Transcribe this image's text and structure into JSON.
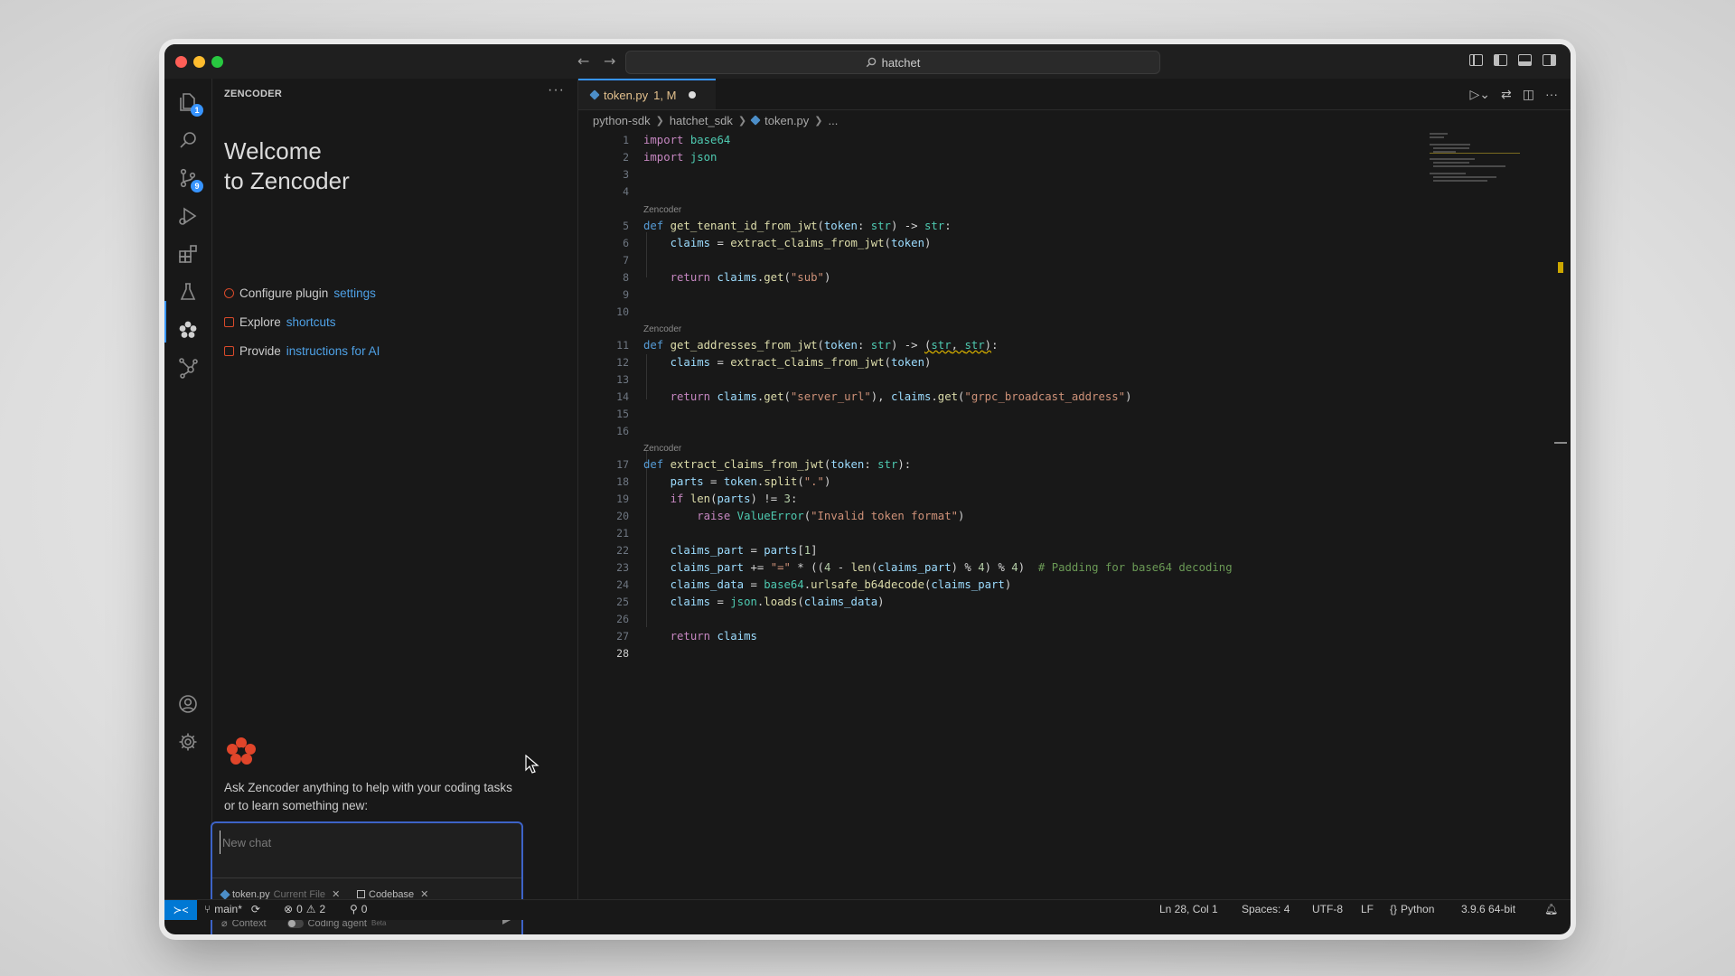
{
  "titlebar": {
    "search_text": "hatchet",
    "back_glyph": "←",
    "forward_glyph": "→"
  },
  "activity_bar": {
    "icons": [
      "files-icon",
      "search-icon",
      "source-control-icon",
      "run-debug-icon",
      "extensions-icon",
      "testing-icon",
      "zencoder-icon",
      "graph-icon",
      "account-icon",
      "settings-icon"
    ],
    "badges": {
      "explorer": "1",
      "source_control": "9"
    }
  },
  "side_panel": {
    "title": "ZENCODER",
    "more": "···",
    "welcome_line1": "Welcome",
    "welcome_line2": "to Zencoder",
    "links": [
      {
        "prefix": "Configure plugin",
        "link": "settings"
      },
      {
        "prefix": "Explore",
        "link": "shortcuts"
      },
      {
        "prefix": "Provide",
        "link": "instructions for AI"
      }
    ],
    "ask_text": "Ask Zencoder anything to help with your coding tasks or to learn something new:",
    "chat": {
      "placeholder": "New chat",
      "chip_file": "token.py",
      "chip_file_sub": "Current File",
      "chip_codebase": "Codebase",
      "context_label": "Context",
      "agent_label": "Coding agent",
      "beta_label": "Beta"
    }
  },
  "tab": {
    "name": "token.py",
    "status": "1, M"
  },
  "breadcrumb": [
    "python-sdk",
    "hatchet_sdk",
    "token.py",
    "..."
  ],
  "code": {
    "lens_label": "Zencoder",
    "line_numbers": [
      "1",
      "2",
      "3",
      "4",
      "5",
      "6",
      "7",
      "8",
      "9",
      "10",
      "11",
      "12",
      "13",
      "14",
      "15",
      "16",
      "17",
      "18",
      "19",
      "20",
      "21",
      "22",
      "23",
      "24",
      "25",
      "26",
      "27",
      "28"
    ]
  },
  "statusbar": {
    "branch": "main*",
    "errors": "0",
    "warnings": "2",
    "ports": "0",
    "position": "Ln 28, Col 1",
    "spaces": "Spaces: 4",
    "encoding": "UTF-8",
    "eol": "LF",
    "language": "Python",
    "interpreter": "3.9.6 64-bit"
  },
  "colors": {
    "accent": "#3794ff",
    "remote": "#0078d4",
    "zencoder_brand": "#e0452a",
    "chat_border": "#3d63c7"
  }
}
